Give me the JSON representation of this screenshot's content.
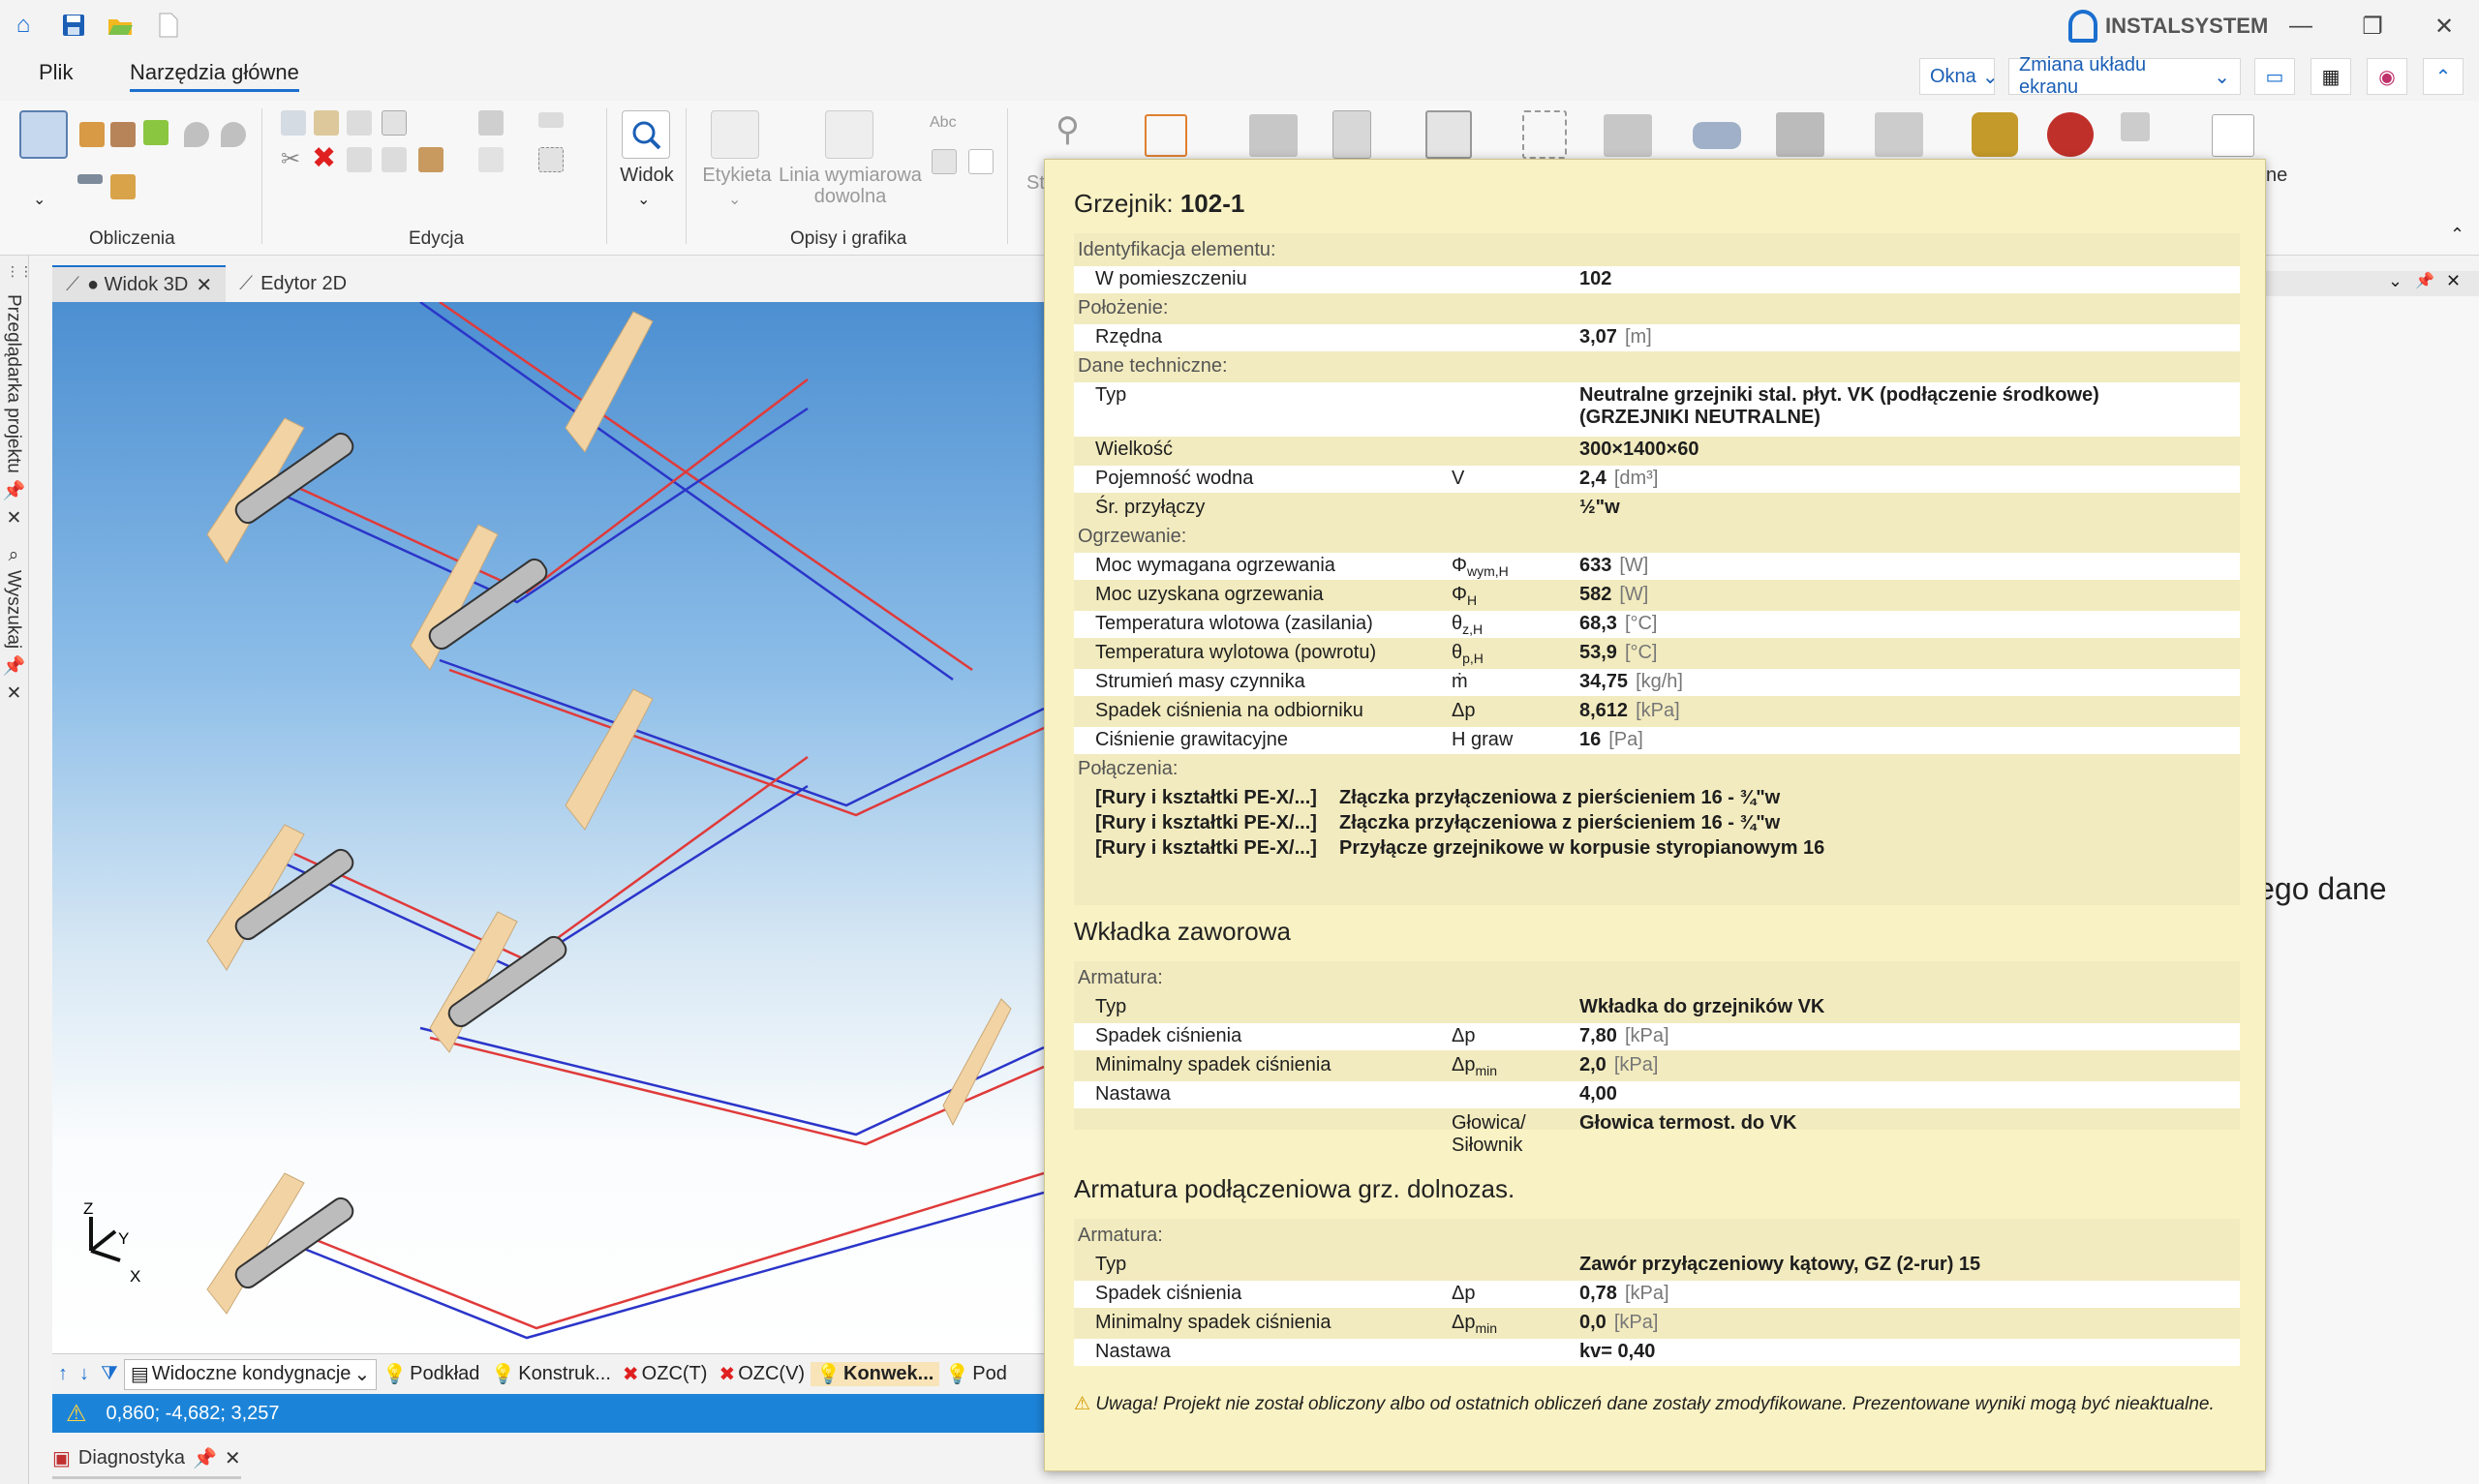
{
  "app": {
    "brand": "INSTALSYSTEM"
  },
  "menu": {
    "file": "Plik",
    "main_tools": "Narzędzia główne"
  },
  "top_right": {
    "windows": "Okna",
    "layout_change": "Zmiana układu ekranu"
  },
  "ribbon": {
    "groups": [
      "Obliczenia",
      "Edycja",
      "Opisy i grafika"
    ],
    "view_label": "Widok",
    "label_btn": "Etykieta",
    "dim_line_btn": "Linia wymiarowa dowolna",
    "abc": "Abc",
    "partial_left": "St",
    "partial_right": "ne"
  },
  "left_panels": {
    "project_browser": "Przeglądarka projektu",
    "search": "Wyszukaj"
  },
  "doc_tabs": [
    {
      "label": "● Widok 3D"
    },
    {
      "label": "Edytor 2D"
    }
  ],
  "layer_bar": {
    "visible_floors": "Widoczne kondygnacje",
    "layers": [
      "Podkład",
      "Konstruk...",
      "OZC(T)",
      "OZC(V)",
      "Konwek...",
      "Pod"
    ]
  },
  "status": {
    "coords": "0,860; -4,682; 3,257"
  },
  "diagnostics": "Diagnostyka",
  "axes": {
    "z": "Z",
    "y": "Y",
    "x": "X"
  },
  "right_panel": {
    "text": "jego dane"
  },
  "tooltip": {
    "title_prefix": "Grzejnik:",
    "title_value": "102-1",
    "rows": [
      {
        "cat": "Identyfikacja elementu:"
      },
      {
        "label": "W pomieszczeniu",
        "sym": "",
        "value": "102",
        "unit": ""
      },
      {
        "cat": "Położenie:"
      },
      {
        "label": "Rzędna",
        "sym": "",
        "value": "3,07",
        "unit": "[m]"
      },
      {
        "cat": "Dane techniczne:"
      },
      {
        "label": "Typ",
        "sym": "",
        "value": "Neutralne grzejniki stal. płyt. VK (podłączenie środkowe)",
        "value2": "(GRZEJNIKI NEUTRALNE)",
        "unit": ""
      },
      {
        "label": "Wielkość",
        "sym": "",
        "value": "300×1400×60",
        "unit": ""
      },
      {
        "label": "Pojemność wodna",
        "sym": "V",
        "value": "2,4",
        "unit": "[dm³]"
      },
      {
        "label": "Śr. przyłączy",
        "sym": "",
        "value": "½\"w",
        "unit": ""
      },
      {
        "cat": "Ogrzewanie:"
      },
      {
        "label": "Moc wymagana ogrzewania",
        "sym": "Φwym,H",
        "value": "633",
        "unit": "[W]"
      },
      {
        "label": "Moc uzyskana ogrzewania",
        "sym": "ΦH",
        "value": "582",
        "unit": "[W]"
      },
      {
        "label": "Temperatura wlotowa (zasilania)",
        "sym": "θz,H",
        "value": "68,3",
        "unit": "[°C]"
      },
      {
        "label": "Temperatura wylotowa (powrotu)",
        "sym": "θp,H",
        "value": "53,9",
        "unit": "[°C]"
      },
      {
        "label": "Strumień masy czynnika",
        "sym": "ṁ",
        "value": "34,75",
        "unit": "[kg/h]"
      },
      {
        "label": "Spadek ciśnienia na odbiorniku",
        "sym": "Δp",
        "value": "8,612",
        "unit": "[kPa]"
      },
      {
        "label": "Ciśnienie grawitacyjne",
        "sym": "H graw",
        "value": "16",
        "unit": "[Pa]"
      },
      {
        "cat": "Połączenia:"
      }
    ],
    "connections": [
      {
        "src": "[Rury i kształtki PE-X/...]",
        "desc": "Złączka przyłączeniowa z pierścieniem 16 - ¾\"w"
      },
      {
        "src": "[Rury i kształtki PE-X/...]",
        "desc": "Złączka przyłączeniowa z pierścieniem 16 - ¾\"w"
      },
      {
        "src": "[Rury i kształtki PE-X/...]",
        "desc": "Przyłącze grzejnikowe w korpusie styropianowym 16"
      }
    ],
    "valve_insert": {
      "title": "Wkładka zaworowa",
      "cat": "Armatura:",
      "rows": [
        {
          "label": "Typ",
          "sym": "",
          "value": "Wkładka do grzejników VK",
          "unit": ""
        },
        {
          "label": "Spadek ciśnienia",
          "sym": "Δp",
          "value": "7,80",
          "unit": "[kPa]"
        },
        {
          "label": "Minimalny spadek ciśnienia",
          "sym": "Δpmin",
          "value": "2,0",
          "unit": "[kPa]"
        },
        {
          "label": "Nastawa",
          "sym": "",
          "value": "4,00",
          "unit": ""
        },
        {
          "label": "",
          "sym": "Głowica/",
          "sym2": "Siłownik",
          "value": "Głowica termost. do VK",
          "unit": ""
        }
      ]
    },
    "connection_fitting": {
      "title": "Armatura podłączeniowa grz. dolnozas.",
      "cat": "Armatura:",
      "rows": [
        {
          "label": "Typ",
          "sym": "",
          "value": "Zawór przyłączeniowy kątowy, GZ (2-rur) 15",
          "unit": ""
        },
        {
          "label": "Spadek ciśnienia",
          "sym": "Δp",
          "value": "0,78",
          "unit": "[kPa]"
        },
        {
          "label": "Minimalny spadek ciśnienia",
          "sym": "Δpmin",
          "value": "0,0",
          "unit": "[kPa]"
        },
        {
          "label": "Nastawa",
          "sym": "",
          "value": "kv= 0,40",
          "unit": ""
        }
      ]
    },
    "warning": "Uwaga! Projekt nie został obliczony albo od ostatnich obliczeń dane zostały zmodyfikowane. Prezentowane wyniki mogą być nieaktualne."
  },
  "colors": {
    "accent": "#1b6fcf",
    "tooltip_bg": "#f9f2c4",
    "status_bar": "#1c84d8",
    "supply_pipe": "#e03a3a",
    "return_pipe": "#2b35c9",
    "radiator": "#f2d3a3"
  }
}
